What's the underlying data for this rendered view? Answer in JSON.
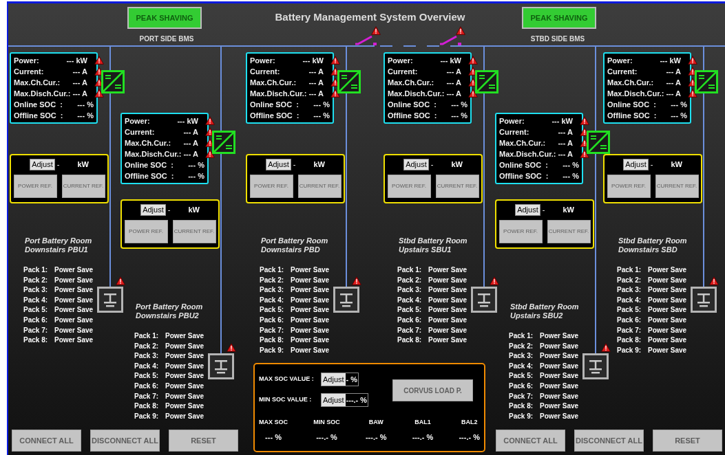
{
  "title": "Battery Management System Overview",
  "sides": [
    {
      "button": {
        "label": "PEAK SHAVING",
        "disabled": true
      },
      "label": "PORT SIDE BMS"
    },
    {
      "button": {
        "label": "PEAK SHAVING",
        "disabled": true
      },
      "label": "STBD SIDE BMS"
    }
  ],
  "breakers": [
    {
      "closed": false,
      "alarm": true
    },
    {
      "closed": false,
      "alarm": true
    }
  ],
  "units": [
    {
      "kind": "upper",
      "battery_alarm": true,
      "room": [
        "Port Battery Room",
        "Downstairs PBU1"
      ],
      "readouts": [
        {
          "label": "Power:",
          "value": "--- kW",
          "alarm": true
        },
        {
          "label": "Current:",
          "value": "--- A",
          "alarm": true
        },
        {
          "label": "Max.Ch.Cur.:",
          "value": "--- A",
          "alarm": true
        },
        {
          "label": "Max.Disch.Cur.:",
          "value": "--- A",
          "alarm": true
        },
        {
          "label": "Online SOC  :",
          "value": "--- %",
          "alarm": false
        },
        {
          "label": "Offline SOC  :",
          "value": "--- %",
          "alarm": false
        }
      ],
      "adjust": {
        "button": "Adjust",
        "value": "-",
        "unit": "kW",
        "buttons": [
          {
            "label": "POWER REF.",
            "disabled": true
          },
          {
            "label": "CURRENT REF.",
            "disabled": true
          }
        ]
      },
      "packs": [
        {
          "label": "Pack 1:",
          "status": "Power Save"
        },
        {
          "label": "Pack 2:",
          "status": "Power Save"
        },
        {
          "label": "Pack 3:",
          "status": "Power Save"
        },
        {
          "label": "Pack 4:",
          "status": "Power Save"
        },
        {
          "label": "Pack 5:",
          "status": "Power Save"
        },
        {
          "label": "Pack 6:",
          "status": "Power Save"
        },
        {
          "label": "Pack 7:",
          "status": "Power Save"
        },
        {
          "label": "Pack 8:",
          "status": "Power Save"
        }
      ]
    },
    {
      "kind": "lower",
      "battery_alarm": true,
      "room": [
        "Port Battery Room",
        "Downstairs PBU2"
      ],
      "readouts": [
        {
          "label": "Power:",
          "value": "--- kW",
          "alarm": true
        },
        {
          "label": "Current:",
          "value": "--- A",
          "alarm": true
        },
        {
          "label": "Max.Ch.Cur.:",
          "value": "--- A",
          "alarm": true
        },
        {
          "label": "Max.Disch.Cur.:",
          "value": "--- A",
          "alarm": true
        },
        {
          "label": "Online SOC  :",
          "value": "--- %",
          "alarm": false
        },
        {
          "label": "Offline SOC  :",
          "value": "--- %",
          "alarm": false
        }
      ],
      "adjust": {
        "button": "Adjust",
        "value": "-",
        "unit": "kW",
        "buttons": [
          {
            "label": "POWER REF.",
            "disabled": true
          },
          {
            "label": "CURRENT REF.",
            "disabled": true
          }
        ]
      },
      "packs": [
        {
          "label": "Pack 1:",
          "status": "Power Save"
        },
        {
          "label": "Pack 2:",
          "status": "Power Save"
        },
        {
          "label": "Pack 3:",
          "status": "Power Save"
        },
        {
          "label": "Pack 4:",
          "status": "Power Save"
        },
        {
          "label": "Pack 5:",
          "status": "Power Save"
        },
        {
          "label": "Pack 6:",
          "status": "Power Save"
        },
        {
          "label": "Pack 7:",
          "status": "Power Save"
        },
        {
          "label": "Pack 8:",
          "status": "Power Save"
        },
        {
          "label": "Pack 9:",
          "status": "Power Save"
        }
      ]
    },
    {
      "kind": "upper",
      "battery_alarm": true,
      "room": [
        "Port Battery Room",
        "Downstairs PBD"
      ],
      "readouts": [
        {
          "label": "Power:",
          "value": "--- kW",
          "alarm": true
        },
        {
          "label": "Current:",
          "value": "--- A",
          "alarm": true
        },
        {
          "label": "Max.Ch.Cur.:",
          "value": "--- A",
          "alarm": true
        },
        {
          "label": "Max.Disch.Cur.:",
          "value": "--- A",
          "alarm": true
        },
        {
          "label": "Online SOC  :",
          "value": "--- %",
          "alarm": false
        },
        {
          "label": "Offline SOC  :",
          "value": "--- %",
          "alarm": false
        }
      ],
      "adjust": {
        "button": "Adjust",
        "value": "-",
        "unit": "kW",
        "buttons": [
          {
            "label": "POWER REF.",
            "disabled": true
          },
          {
            "label": "CURRENT REF.",
            "disabled": true
          }
        ]
      },
      "packs": [
        {
          "label": "Pack 1:",
          "status": "Power Save"
        },
        {
          "label": "Pack 2:",
          "status": "Power Save"
        },
        {
          "label": "Pack 3:",
          "status": "Power Save"
        },
        {
          "label": "Pack 4:",
          "status": "Power Save"
        },
        {
          "label": "Pack 5:",
          "status": "Power Save"
        },
        {
          "label": "Pack 6:",
          "status": "Power Save"
        },
        {
          "label": "Pack 7:",
          "status": "Power Save"
        },
        {
          "label": "Pack 8:",
          "status": "Power Save"
        },
        {
          "label": "Pack 9:",
          "status": "Power Save"
        }
      ]
    },
    {
      "kind": "upper",
      "battery_alarm": true,
      "room": [
        "Stbd Battery Room",
        "Upstairs SBU1"
      ],
      "readouts": [
        {
          "label": "Power:",
          "value": "--- kW",
          "alarm": true
        },
        {
          "label": "Current:",
          "value": "--- A",
          "alarm": true
        },
        {
          "label": "Max.Ch.Cur.:",
          "value": "--- A",
          "alarm": true
        },
        {
          "label": "Max.Disch.Cur.:",
          "value": "--- A",
          "alarm": true
        },
        {
          "label": "Online SOC  :",
          "value": "--- %",
          "alarm": false
        },
        {
          "label": "Offline SOC  :",
          "value": "--- %",
          "alarm": false
        }
      ],
      "adjust": {
        "button": "Adjust",
        "value": "-",
        "unit": "kW",
        "buttons": [
          {
            "label": "POWER REF.",
            "disabled": true
          },
          {
            "label": "CURRENT REF.",
            "disabled": true
          }
        ]
      },
      "packs": [
        {
          "label": "Pack 1:",
          "status": "Power Save"
        },
        {
          "label": "Pack 2:",
          "status": "Power Save"
        },
        {
          "label": "Pack 3:",
          "status": "Power Save"
        },
        {
          "label": "Pack 4:",
          "status": "Power Save"
        },
        {
          "label": "Pack 5:",
          "status": "Power Save"
        },
        {
          "label": "Pack 6:",
          "status": "Power Save"
        },
        {
          "label": "Pack 7:",
          "status": "Power Save"
        },
        {
          "label": "Pack 8:",
          "status": "Power Save"
        }
      ]
    },
    {
      "kind": "lower",
      "battery_alarm": true,
      "room": [
        "Stbd Battery Room",
        "Upstairs SBU2"
      ],
      "readouts": [
        {
          "label": "Power:",
          "value": "--- kW",
          "alarm": true
        },
        {
          "label": "Current:",
          "value": "--- A",
          "alarm": true
        },
        {
          "label": "Max.Ch.Cur.:",
          "value": "--- A",
          "alarm": true
        },
        {
          "label": "Max.Disch.Cur.:",
          "value": "--- A",
          "alarm": true
        },
        {
          "label": "Online SOC  :",
          "value": "--- %",
          "alarm": false
        },
        {
          "label": "Offline SOC  :",
          "value": "--- %",
          "alarm": false
        }
      ],
      "adjust": {
        "button": "Adjust",
        "value": "-",
        "unit": "kW",
        "buttons": [
          {
            "label": "POWER REF.",
            "disabled": true
          },
          {
            "label": "CURRENT REF.",
            "disabled": true
          }
        ]
      },
      "packs": [
        {
          "label": "Pack 1:",
          "status": "Power Save"
        },
        {
          "label": "Pack 2:",
          "status": "Power Save"
        },
        {
          "label": "Pack 3:",
          "status": "Power Save"
        },
        {
          "label": "Pack 4:",
          "status": "Power Save"
        },
        {
          "label": "Pack 5:",
          "status": "Power Save"
        },
        {
          "label": "Pack 6:",
          "status": "Power Save"
        },
        {
          "label": "Pack 7:",
          "status": "Power Save"
        },
        {
          "label": "Pack 8:",
          "status": "Power Save"
        },
        {
          "label": "Pack 9:",
          "status": "Power Save"
        }
      ]
    },
    {
      "kind": "upper",
      "battery_alarm": true,
      "room": [
        "Stbd Battery Room",
        "Downstairs SBD"
      ],
      "readouts": [
        {
          "label": "Power:",
          "value": "--- kW",
          "alarm": true
        },
        {
          "label": "Current:",
          "value": "--- A",
          "alarm": true
        },
        {
          "label": "Max.Ch.Cur.:",
          "value": "--- A",
          "alarm": true
        },
        {
          "label": "Max.Disch.Cur.:",
          "value": "--- A",
          "alarm": true
        },
        {
          "label": "Online SOC  :",
          "value": "--- %",
          "alarm": false
        },
        {
          "label": "Offline SOC  :",
          "value": "--- %",
          "alarm": false
        }
      ],
      "adjust": {
        "button": "Adjust",
        "value": "-",
        "unit": "kW",
        "buttons": [
          {
            "label": "POWER REF.",
            "disabled": true
          },
          {
            "label": "CURRENT REF.",
            "disabled": true
          }
        ]
      },
      "packs": [
        {
          "label": "Pack 1:",
          "status": "Power Save"
        },
        {
          "label": "Pack 2:",
          "status": "Power Save"
        },
        {
          "label": "Pack 3:",
          "status": "Power Save"
        },
        {
          "label": "Pack 4:",
          "status": "Power Save"
        },
        {
          "label": "Pack 5:",
          "status": "Power Save"
        },
        {
          "label": "Pack 6:",
          "status": "Power Save"
        },
        {
          "label": "Pack 7:",
          "status": "Power Save"
        },
        {
          "label": "Pack 8:",
          "status": "Power Save"
        },
        {
          "label": "Pack 9:",
          "status": "Power Save"
        }
      ]
    }
  ],
  "port_buttons": [
    {
      "label": "CONNECT ALL",
      "disabled": true
    },
    {
      "label": "DISCONNECT ALL",
      "disabled": true
    },
    {
      "label": "RESET",
      "disabled": true
    }
  ],
  "soc_panel": {
    "rows": [
      {
        "label": "MAX SOC VALUE :",
        "button": "Adjust",
        "value": "- %"
      },
      {
        "label": "MIN SOC VALUE :",
        "button": "Adjust",
        "value": "---.- %"
      }
    ],
    "load_button": {
      "label": "CORVUS LOAD P.",
      "disabled": true
    },
    "stats": [
      {
        "label": "MAX SOC",
        "value": "--- %"
      },
      {
        "label": "MIN SOC",
        "value": "---.- %"
      },
      {
        "label": "BAW",
        "value": "---.- %"
      },
      {
        "label": "BAL1",
        "value": "---.- %"
      },
      {
        "label": "BAL2",
        "value": "---.- %"
      }
    ]
  },
  "stbd_buttons": [
    {
      "label": "CONNECT ALL",
      "disabled": true
    },
    {
      "label": "DISCONNECT ALL",
      "disabled": true
    },
    {
      "label": "RESET",
      "disabled": true
    }
  ]
}
